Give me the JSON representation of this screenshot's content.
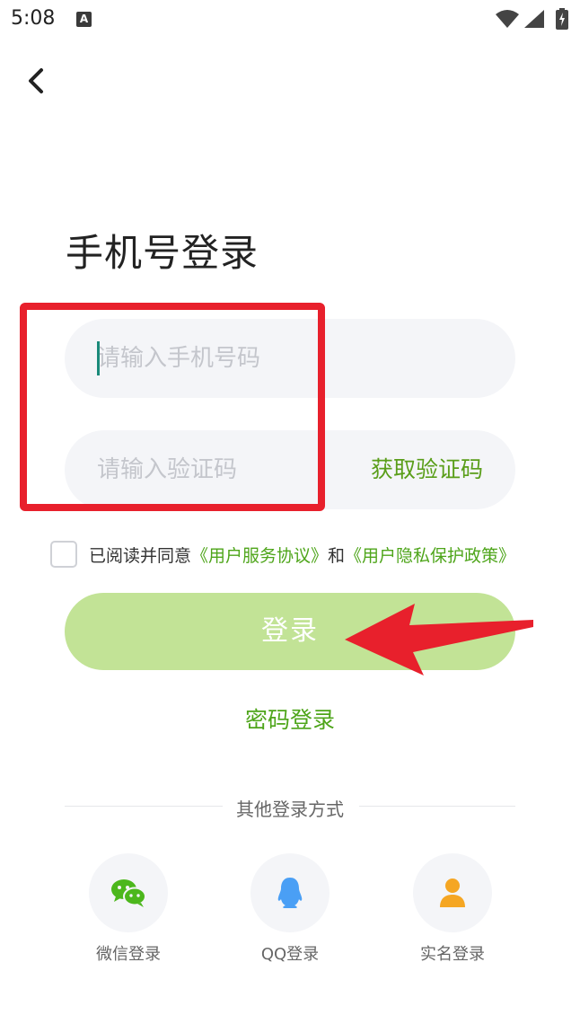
{
  "status_bar": {
    "time": "5:08",
    "notification_icon": "A"
  },
  "title": "手机号登录",
  "phone_input": {
    "placeholder": "请输入手机号码",
    "value": ""
  },
  "code_input": {
    "placeholder": "请输入验证码",
    "value": ""
  },
  "get_code_label": "获取验证码",
  "agreement": {
    "prefix": "已阅读并同意",
    "user_agreement": "《用户服务协议》",
    "and": "和",
    "privacy_policy": "《用户隐私保护政策》",
    "checked": false
  },
  "login_button_label": "登录",
  "password_login_label": "密码登录",
  "other_login_label": "其他登录方式",
  "social": [
    {
      "label": "微信登录",
      "icon": "wechat-icon",
      "color": "#4cb71c"
    },
    {
      "label": "QQ登录",
      "icon": "qq-penguin-icon",
      "color": "#4a9ff5"
    },
    {
      "label": "实名登录",
      "icon": "person-icon",
      "color": "#f5a623"
    }
  ],
  "colors": {
    "accent_green": "#4ea51a",
    "login_button_bg": "#c2e396",
    "annotation_red": "#e8202c"
  }
}
